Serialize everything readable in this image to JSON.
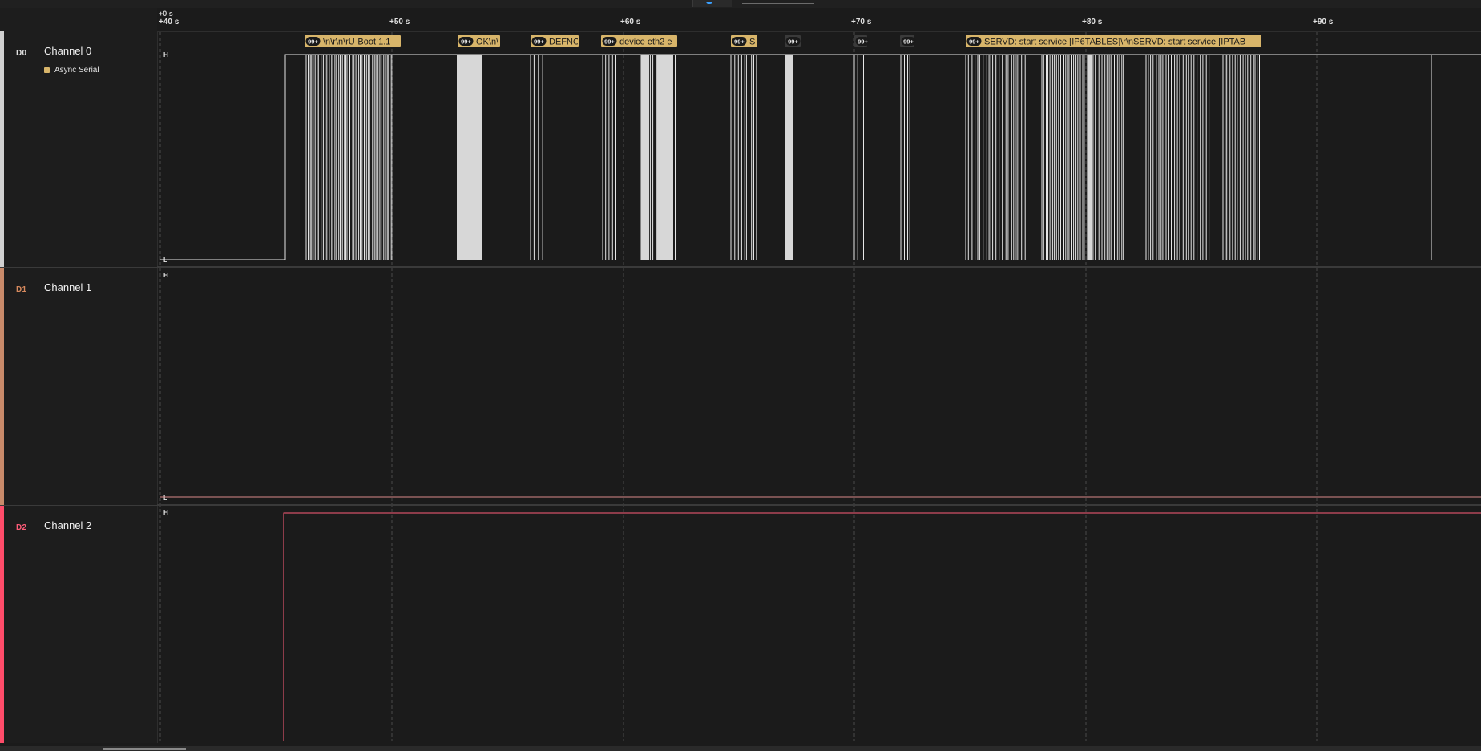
{
  "timeline": {
    "origin_label": "+0 s",
    "ticks": [
      "+40 s",
      "+50 s",
      "+60 s",
      "+70 s",
      "+80 s",
      "+90 s"
    ]
  },
  "channels": [
    {
      "id": "D0",
      "name": "Channel 0",
      "color": "#d0d0d0",
      "analyzer": "Async Serial",
      "high_label": "H",
      "low_label": "L"
    },
    {
      "id": "D1",
      "name": "Channel 1",
      "color": "#c98a6a",
      "high_label": "H",
      "low_label": "L"
    },
    {
      "id": "D2",
      "name": "Channel 2",
      "color": "#ff4c6a",
      "high_label": "H"
    }
  ],
  "annotations": [
    {
      "count": "99+",
      "text": "\\n\\r\\n\\rU-Boot 1.1"
    },
    {
      "count": "99+",
      "text": "OK\\n\\"
    },
    {
      "count": "99+",
      "text": "DEFNO"
    },
    {
      "count": "99+",
      "text": "device eth2 e"
    },
    {
      "count": "99+",
      "text": "S"
    },
    {
      "count": "99+",
      "text": ""
    },
    {
      "count": "99+",
      "text": ""
    },
    {
      "count": "99+",
      "text": ""
    },
    {
      "count": "99+",
      "text": "SERVD: start service [IP6TABLES]\\r\\nSERVD: start service [IPTAB"
    }
  ],
  "colors": {
    "background": "#1b1b1b",
    "grid": "#4a4a4a",
    "annotation_fill": "#d8b56a",
    "annotation_text": "#1a1a1a",
    "channel1_trace": "#d98a8a",
    "channel2_trace": "#ff5c78"
  }
}
